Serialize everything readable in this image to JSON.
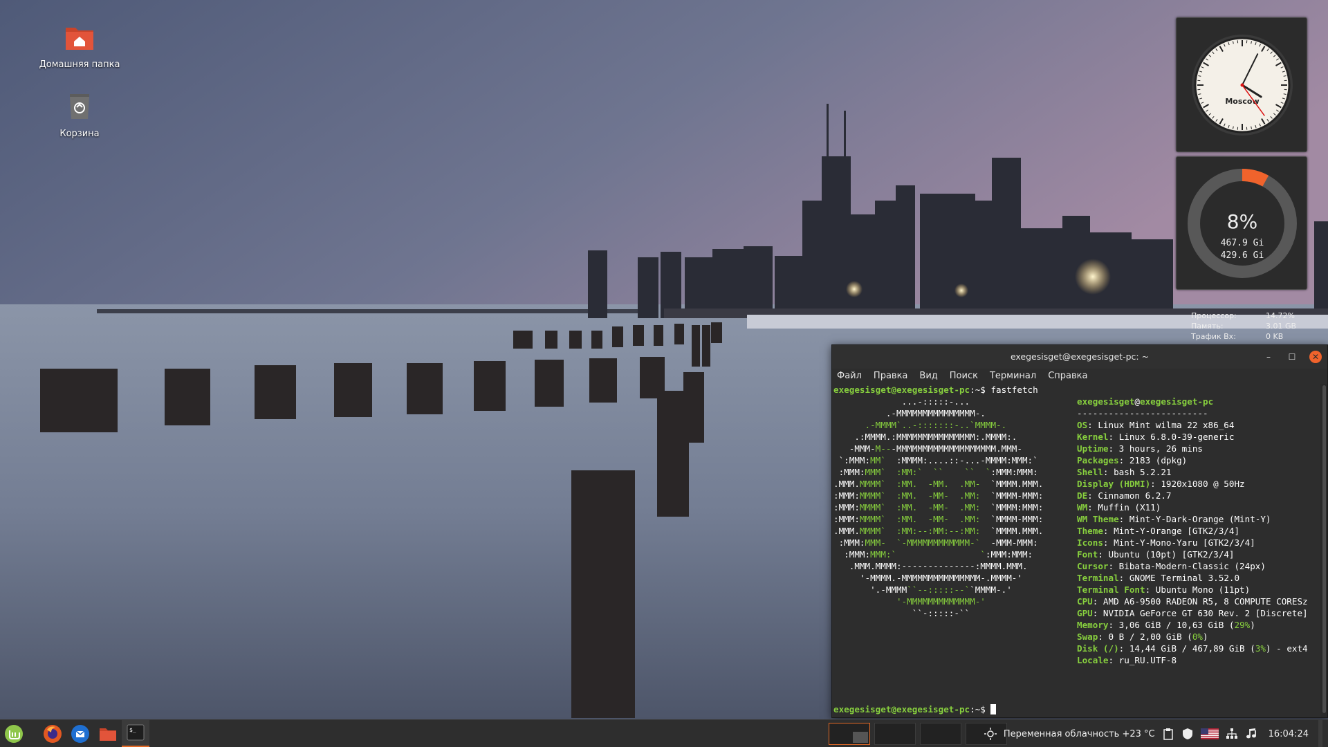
{
  "desktop": {
    "icons": [
      {
        "label": "Домашняя папка",
        "icon": "home-folder-icon"
      },
      {
        "label": "Корзина",
        "icon": "trash-icon"
      }
    ]
  },
  "clock_desklet": {
    "city": "Moscow",
    "time": "16:04:24"
  },
  "disk_desklet": {
    "percent": "8%",
    "used": "467.9 Gi",
    "free": "429.6 Gi",
    "fill_fraction": 0.08,
    "accent": "#f0632c"
  },
  "stats_desklet": {
    "rows": [
      {
        "key": "Процессор:",
        "value": "14.72%"
      },
      {
        "key": "Память:",
        "value": "3.01 GB"
      },
      {
        "key": "Трафик Вх:",
        "value": "0 KB"
      }
    ]
  },
  "terminal": {
    "title": "exegesisget@exegesisget-pc: ~",
    "menu": [
      "Файл",
      "Правка",
      "Вид",
      "Поиск",
      "Терминал",
      "Справка"
    ],
    "prompt_user": "exegesisget@exegesisget-pc",
    "prompt_path": ":~$",
    "command": " fastfetch",
    "logo": [
      "             ...-:::::-...",
      "          .-MMMMMMMMMMMMMMM-.",
      "      .-MMMM`..-:::::::-..`MMMM-.",
      "    .:MMMM.:MMMMMMMMMMMMMMM:.MMMM:.",
      "   -MMM-M---MMMMMMMMMMMMMMMMMMM.MMM-",
      " `:MMM:MM`  :MMMM:....::-...-MMMM:MMM:`",
      " :MMM:MMM`  :MM:`  ``    ``  `:MMM:MMM:",
      ".MMM.MMMM`  :MM.  -MM.  .MM-  `MMMM.MMM.",
      ":MMM:MMMM`  :MM.  -MM-  .MM:  `MMMM-MMM:",
      ":MMM:MMMM`  :MM.  -MM-  .MM:  `MMMM:MMM:",
      ":MMM:MMMM`  :MM.  -MM-  .MM:  `MMMM-MMM:",
      ".MMM.MMMM`  :MM:--:MM:--:MM:  `MMMM.MMM.",
      " :MMM:MMM-  `-MMMMMMMMMMMM-`  -MMM-MMM:",
      "  :MMM:MMM:`                `:MMM:MMM:",
      "   .MMM.MMMM:--------------:MMMM.MMM.",
      "     '-MMMM.-MMMMMMMMMMMMMMM-.MMMM-'",
      "       '.-MMMM``--:::::--``MMMM-.'",
      "            '-MMMMMMMMMMMMM-'",
      "               ``-:::::-``"
    ],
    "info_header_user": "exegesisget",
    "info_header_host": "exegesisget-pc",
    "info_separator": "-------------------------",
    "info": [
      {
        "k": "OS",
        "v": ": Linux Mint wilma 22 x86_64"
      },
      {
        "k": "Kernel",
        "v": ": Linux 6.8.0-39-generic"
      },
      {
        "k": "Uptime",
        "v": ": 3 hours, 26 mins"
      },
      {
        "k": "Packages",
        "v": ": 2183 (dpkg)"
      },
      {
        "k": "Shell",
        "v": ": bash 5.2.21"
      },
      {
        "k": "Display (HDMI)",
        "v": ": 1920x1080 @ 50Hz"
      },
      {
        "k": "DE",
        "v": ": Cinnamon 6.2.7"
      },
      {
        "k": "WM",
        "v": ": Muffin (X11)"
      },
      {
        "k": "WM Theme",
        "v": ": Mint-Y-Dark-Orange (Mint-Y)"
      },
      {
        "k": "Theme",
        "v": ": Mint-Y-Orange [GTK2/3/4]"
      },
      {
        "k": "Icons",
        "v": ": Mint-Y-Mono-Yaru [GTK2/3/4]"
      },
      {
        "k": "Font",
        "v": ": Ubuntu (10pt) [GTK2/3/4]"
      },
      {
        "k": "Cursor",
        "v": ": Bibata-Modern-Classic (24px)"
      },
      {
        "k": "Terminal",
        "v": ": GNOME Terminal 3.52.0"
      },
      {
        "k": "Terminal Font",
        "v": ": Ubuntu Mono (11pt)"
      },
      {
        "k": "CPU",
        "v": ": AMD A6-9500 RADEON R5, 8 COMPUTE CORESz"
      },
      {
        "k": "GPU",
        "v": ": NVIDIA GeForce GT 630 Rev. 2 [Discrete]"
      },
      {
        "k": "Memory",
        "v": ": 3,06 GiB / 10,63 GiB (",
        "pct": "29%",
        "tail": ")"
      },
      {
        "k": "Swap",
        "v": ": 0 B / 2,00 GiB (",
        "pct": "0%",
        "tail": ")"
      },
      {
        "k": "Disk (/)",
        "v": ": 14,44 GiB / 467,89 GiB (",
        "pct": "3%",
        "tail": ") - ext4"
      },
      {
        "k": "Locale",
        "v": ": ru_RU.UTF-8"
      }
    ],
    "palette": [
      "#3a3a3a",
      "#e01b24",
      "#5fb340",
      "#e5c21a",
      "#3a6fb7",
      "#a06bb1",
      "#2bc0c0",
      "#e0e0e0",
      "#5a5a5a",
      "#ee3030",
      "#87cf3e",
      "#f2d43a",
      "#5d8fd4",
      "#c48ad4",
      "#46dede",
      "#ffffff"
    ]
  },
  "panel": {
    "weather": "Переменная облачность +23 °C",
    "clock": "16:04:24",
    "launchers": [
      "mint-menu-icon",
      "firefox-icon",
      "thunderbird-icon",
      "files-icon",
      "terminal-icon"
    ],
    "accent": "#e46a26"
  }
}
